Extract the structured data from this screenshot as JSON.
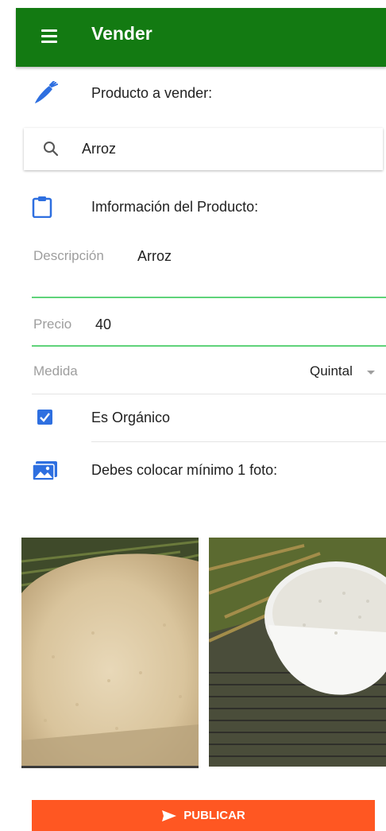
{
  "appbar": {
    "title": "Vender",
    "color": "#137a12",
    "menu_icon": "menu-icon"
  },
  "product": {
    "label": "Producto a vender:",
    "icon": "carrot-icon"
  },
  "search": {
    "icon": "search-icon",
    "value": "Arroz"
  },
  "info": {
    "label": "Imformación del Producto:",
    "icon": "clipboard-icon"
  },
  "form": {
    "description": {
      "label": "Descripción",
      "value": "Arroz"
    },
    "price": {
      "label": "Precio",
      "value": "40"
    },
    "measure": {
      "label": "Medida",
      "value": "Quintal"
    },
    "organic": {
      "label": "Es Orgánico",
      "checked": true
    },
    "accent_color": "#5fd37a"
  },
  "photos": {
    "label": "Debes colocar mínimo 1 foto:",
    "icon": "image-icon"
  },
  "publish": {
    "label": "PUBLICAR",
    "icon": "send-icon",
    "color": "#ff5722"
  }
}
